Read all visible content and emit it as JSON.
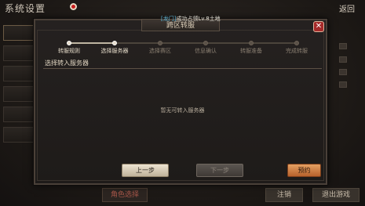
{
  "background": {
    "title": "系统设置",
    "back_label": "返回",
    "sidebar_items": [
      "",
      "",
      "",
      "",
      "",
      ""
    ],
    "footer": {
      "role_label": "角色选择",
      "logout_label": "注销",
      "exit_label": "退出游戏"
    }
  },
  "broadcast": {
    "tag": "[龙门]",
    "text": "成功占领Lv.8土地"
  },
  "modal": {
    "title": "跨区转服",
    "close_symbol": "✕",
    "steps": [
      {
        "label": "转服规则",
        "done": true
      },
      {
        "label": "选择服务器",
        "done": true
      },
      {
        "label": "选择赛区",
        "done": false
      },
      {
        "label": "信息确认",
        "done": false
      },
      {
        "label": "转服准备",
        "done": false
      },
      {
        "label": "完成转服",
        "done": false
      }
    ],
    "section_label": "选择转入服务器",
    "empty_text": "暂无可转入服务器",
    "buttons": {
      "prev": "上一步",
      "next": "下一步",
      "reserve": "预约"
    }
  },
  "colors": {
    "accent_orange": "#d6843f",
    "close_red": "#a52a2a",
    "broadcast_blue": "#5fb7d8"
  }
}
